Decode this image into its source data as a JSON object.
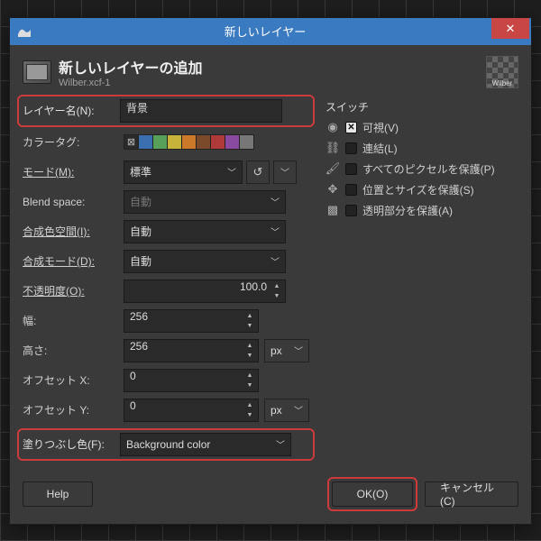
{
  "titlebar": {
    "title": "新しいレイヤー"
  },
  "header": {
    "title": "新しいレイヤーの追加",
    "sub": "Wilber.xcf-1",
    "thumb": "Wilber"
  },
  "labels": {
    "name": "レイヤー名(N):",
    "colortag": "カラータグ:",
    "mode": "モード(M):",
    "blend": "Blend space:",
    "compspace": "合成色空間(I):",
    "compmode": "合成モード(D):",
    "opacity": "不透明度(O):",
    "width": "幅:",
    "height": "高さ:",
    "offx": "オフセット X:",
    "offy": "オフセット Y:",
    "fill": "塗りつぶし色(F):"
  },
  "values": {
    "name": "背景",
    "mode": "標準",
    "blend": "自動",
    "compspace": "自動",
    "compmode": "自動",
    "opacity": "100.0",
    "width": "256",
    "height": "256",
    "offx": "0",
    "offy": "0",
    "unit": "px",
    "fill": "Background color"
  },
  "colortags": [
    "#3a6fb0",
    "#58a05a",
    "#c7b23a",
    "#cc7a2a",
    "#7a4a2a",
    "#b03a3a",
    "#8a4aa0",
    "#777777"
  ],
  "switches": {
    "title": "スイッチ",
    "items": [
      {
        "icon": "eye",
        "label": "可視(V)",
        "checked": true
      },
      {
        "icon": "link",
        "label": "連結(L)",
        "checked": false
      },
      {
        "icon": "brush",
        "label": "すべてのピクセルを保護(P)",
        "checked": false
      },
      {
        "icon": "move",
        "label": "位置とサイズを保護(S)",
        "checked": false
      },
      {
        "icon": "alpha",
        "label": "透明部分を保護(A)",
        "checked": false
      }
    ]
  },
  "buttons": {
    "help": "Help",
    "ok": "OK(O)",
    "cancel": "キャンセル(C)"
  }
}
